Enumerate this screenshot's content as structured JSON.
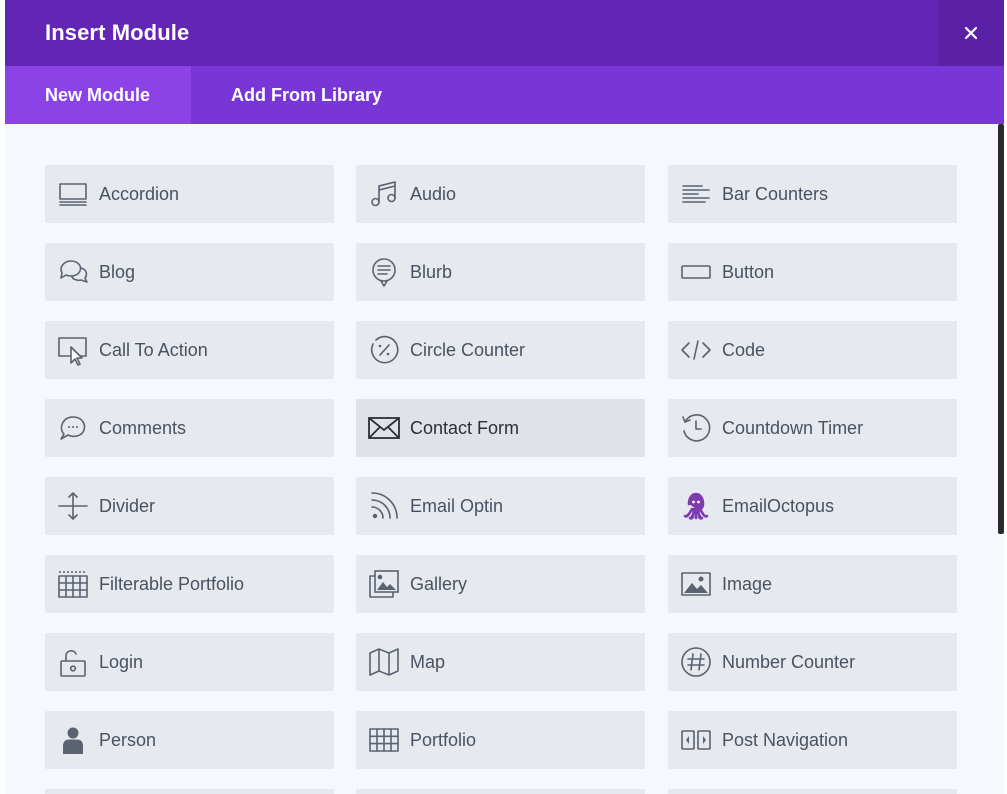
{
  "header": {
    "title": "Insert Module",
    "close_icon": "close-icon"
  },
  "tabs": [
    {
      "label": "New Module",
      "active": true
    },
    {
      "label": "Add From Library",
      "active": false
    }
  ],
  "colors": {
    "header": "#6325b4",
    "tabs": "#7836d6",
    "active_tab": "#8b42e6",
    "tile": "#e6e9ed",
    "icon": "#5b6270",
    "emailoctopus": "#7e3bb0"
  },
  "modules": [
    {
      "label": "Accordion",
      "icon": "accordion-icon"
    },
    {
      "label": "Audio",
      "icon": "audio-icon"
    },
    {
      "label": "Bar Counters",
      "icon": "bar-counters-icon"
    },
    {
      "label": "Blog",
      "icon": "blog-icon"
    },
    {
      "label": "Blurb",
      "icon": "blurb-icon"
    },
    {
      "label": "Button",
      "icon": "button-icon"
    },
    {
      "label": "Call To Action",
      "icon": "call-to-action-icon"
    },
    {
      "label": "Circle Counter",
      "icon": "circle-counter-icon"
    },
    {
      "label": "Code",
      "icon": "code-icon"
    },
    {
      "label": "Comments",
      "icon": "comments-icon"
    },
    {
      "label": "Contact Form",
      "icon": "contact-form-icon",
      "hovered": true
    },
    {
      "label": "Countdown Timer",
      "icon": "countdown-timer-icon"
    },
    {
      "label": "Divider",
      "icon": "divider-icon"
    },
    {
      "label": "Email Optin",
      "icon": "email-optin-icon"
    },
    {
      "label": "EmailOctopus",
      "icon": "emailoctopus-icon"
    },
    {
      "label": "Filterable Portfolio",
      "icon": "filterable-portfolio-icon"
    },
    {
      "label": "Gallery",
      "icon": "gallery-icon"
    },
    {
      "label": "Image",
      "icon": "image-icon"
    },
    {
      "label": "Login",
      "icon": "login-icon"
    },
    {
      "label": "Map",
      "icon": "map-icon"
    },
    {
      "label": "Number Counter",
      "icon": "number-counter-icon"
    },
    {
      "label": "Person",
      "icon": "person-icon"
    },
    {
      "label": "Portfolio",
      "icon": "portfolio-icon"
    },
    {
      "label": "Post Navigation",
      "icon": "post-navigation-icon"
    }
  ]
}
